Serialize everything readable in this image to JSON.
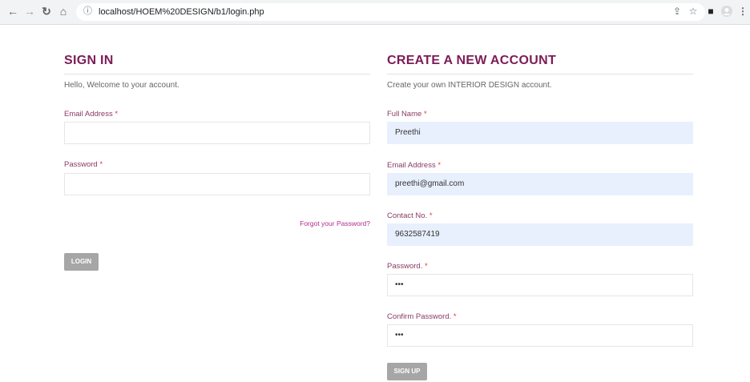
{
  "browser": {
    "url": "localhost/HOEM%20DESIGN/b1/login.php",
    "icons": [
      "back-arrow-icon",
      "forward-arrow-icon",
      "reload-icon",
      "home-icon",
      "info-icon",
      "share-icon",
      "star-icon",
      "sidebar-icon",
      "profile-icon",
      "menu-icon"
    ]
  },
  "signin": {
    "title": "SIGN IN",
    "welcome": "Hello, Welcome to your account.",
    "email_label": "Email Address",
    "email_value": "",
    "password_label": "Password",
    "password_value": "",
    "forgot": "Forgot your Password?",
    "login_button": "LOGIN",
    "required_mark": "*"
  },
  "signup": {
    "title": "CREATE A NEW ACCOUNT",
    "intro": "Create your own INTERIOR DESIGN account.",
    "fullname_label": "Full Name",
    "fullname_value": "Preethi",
    "email_label": "Email Address",
    "email_value": "preethi@gmail.com",
    "contact_label": "Contact No.",
    "contact_value": "9632587419",
    "password_label": "Password.",
    "password_value": "•••",
    "confirm_label": "Confirm Password.",
    "confirm_value": "•••",
    "signup_button": "SIGN UP",
    "required_mark": "*"
  },
  "colors": {
    "heading": "#7b1c57",
    "label": "#8a3b63",
    "link": "#b12c8e",
    "required": "#e33333",
    "button": "#a6a6a6",
    "autofill": "#e8f0fe"
  }
}
